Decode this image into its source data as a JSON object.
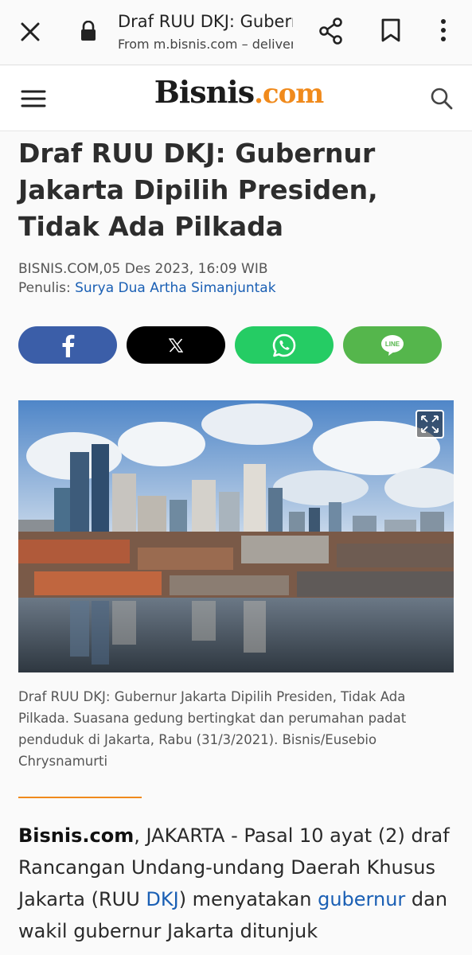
{
  "browser": {
    "title": "Draf RUU DKJ: Gubernur Jakarta Dipilih Presiden, Tidak Ada Pilkada",
    "subtitle": "From m.bisnis.com – delivered by Google",
    "icons": [
      "close-icon",
      "lock-icon",
      "share-icon",
      "bookmark-icon",
      "more-vert-icon"
    ]
  },
  "site": {
    "logo_main": "Bisnis",
    "logo_dot": ".com",
    "icons": [
      "hamburger-menu-icon",
      "search-icon"
    ]
  },
  "article": {
    "headline": "Draf RUU DKJ: Gubernur Jakarta Dipilih Presiden, Tidak Ada Pilkada",
    "source_date": "BISNIS.COM,05 Des 2023, 16:09 WIB",
    "author_label": "Penulis:",
    "author_name": "Surya Dua Artha Simanjuntak",
    "share_buttons": [
      "facebook-icon",
      "x-icon",
      "whatsapp-icon",
      "line-icon"
    ],
    "line_text": "LINE",
    "caption": "Draf RUU DKJ: Gubernur Jakarta Dipilih Presiden, Tidak Ada Pilkada. Suasana gedung bertingkat dan perumahan padat penduduk di Jakarta, Rabu (31/3/2021). Bisnis/Eusebio Chrysnamurti",
    "body_brand": "Bisnis.com",
    "body_part1": ", JAKARTA - Pasal 10 ayat (2) draf Rancangan Undang-undang Daerah Khusus Jakarta (RUU ",
    "body_link1": "DKJ",
    "body_part2": ") menyatakan ",
    "body_link2": "gubernur",
    "body_part3": " dan wakil gubernur Jakarta ditunjuk"
  },
  "colors": {
    "accent": "#f08a1c",
    "link": "#1a5fb4",
    "facebook": "#3b5ea8",
    "x": "#000000",
    "whatsapp": "#25cc64",
    "line": "#55b64c"
  }
}
